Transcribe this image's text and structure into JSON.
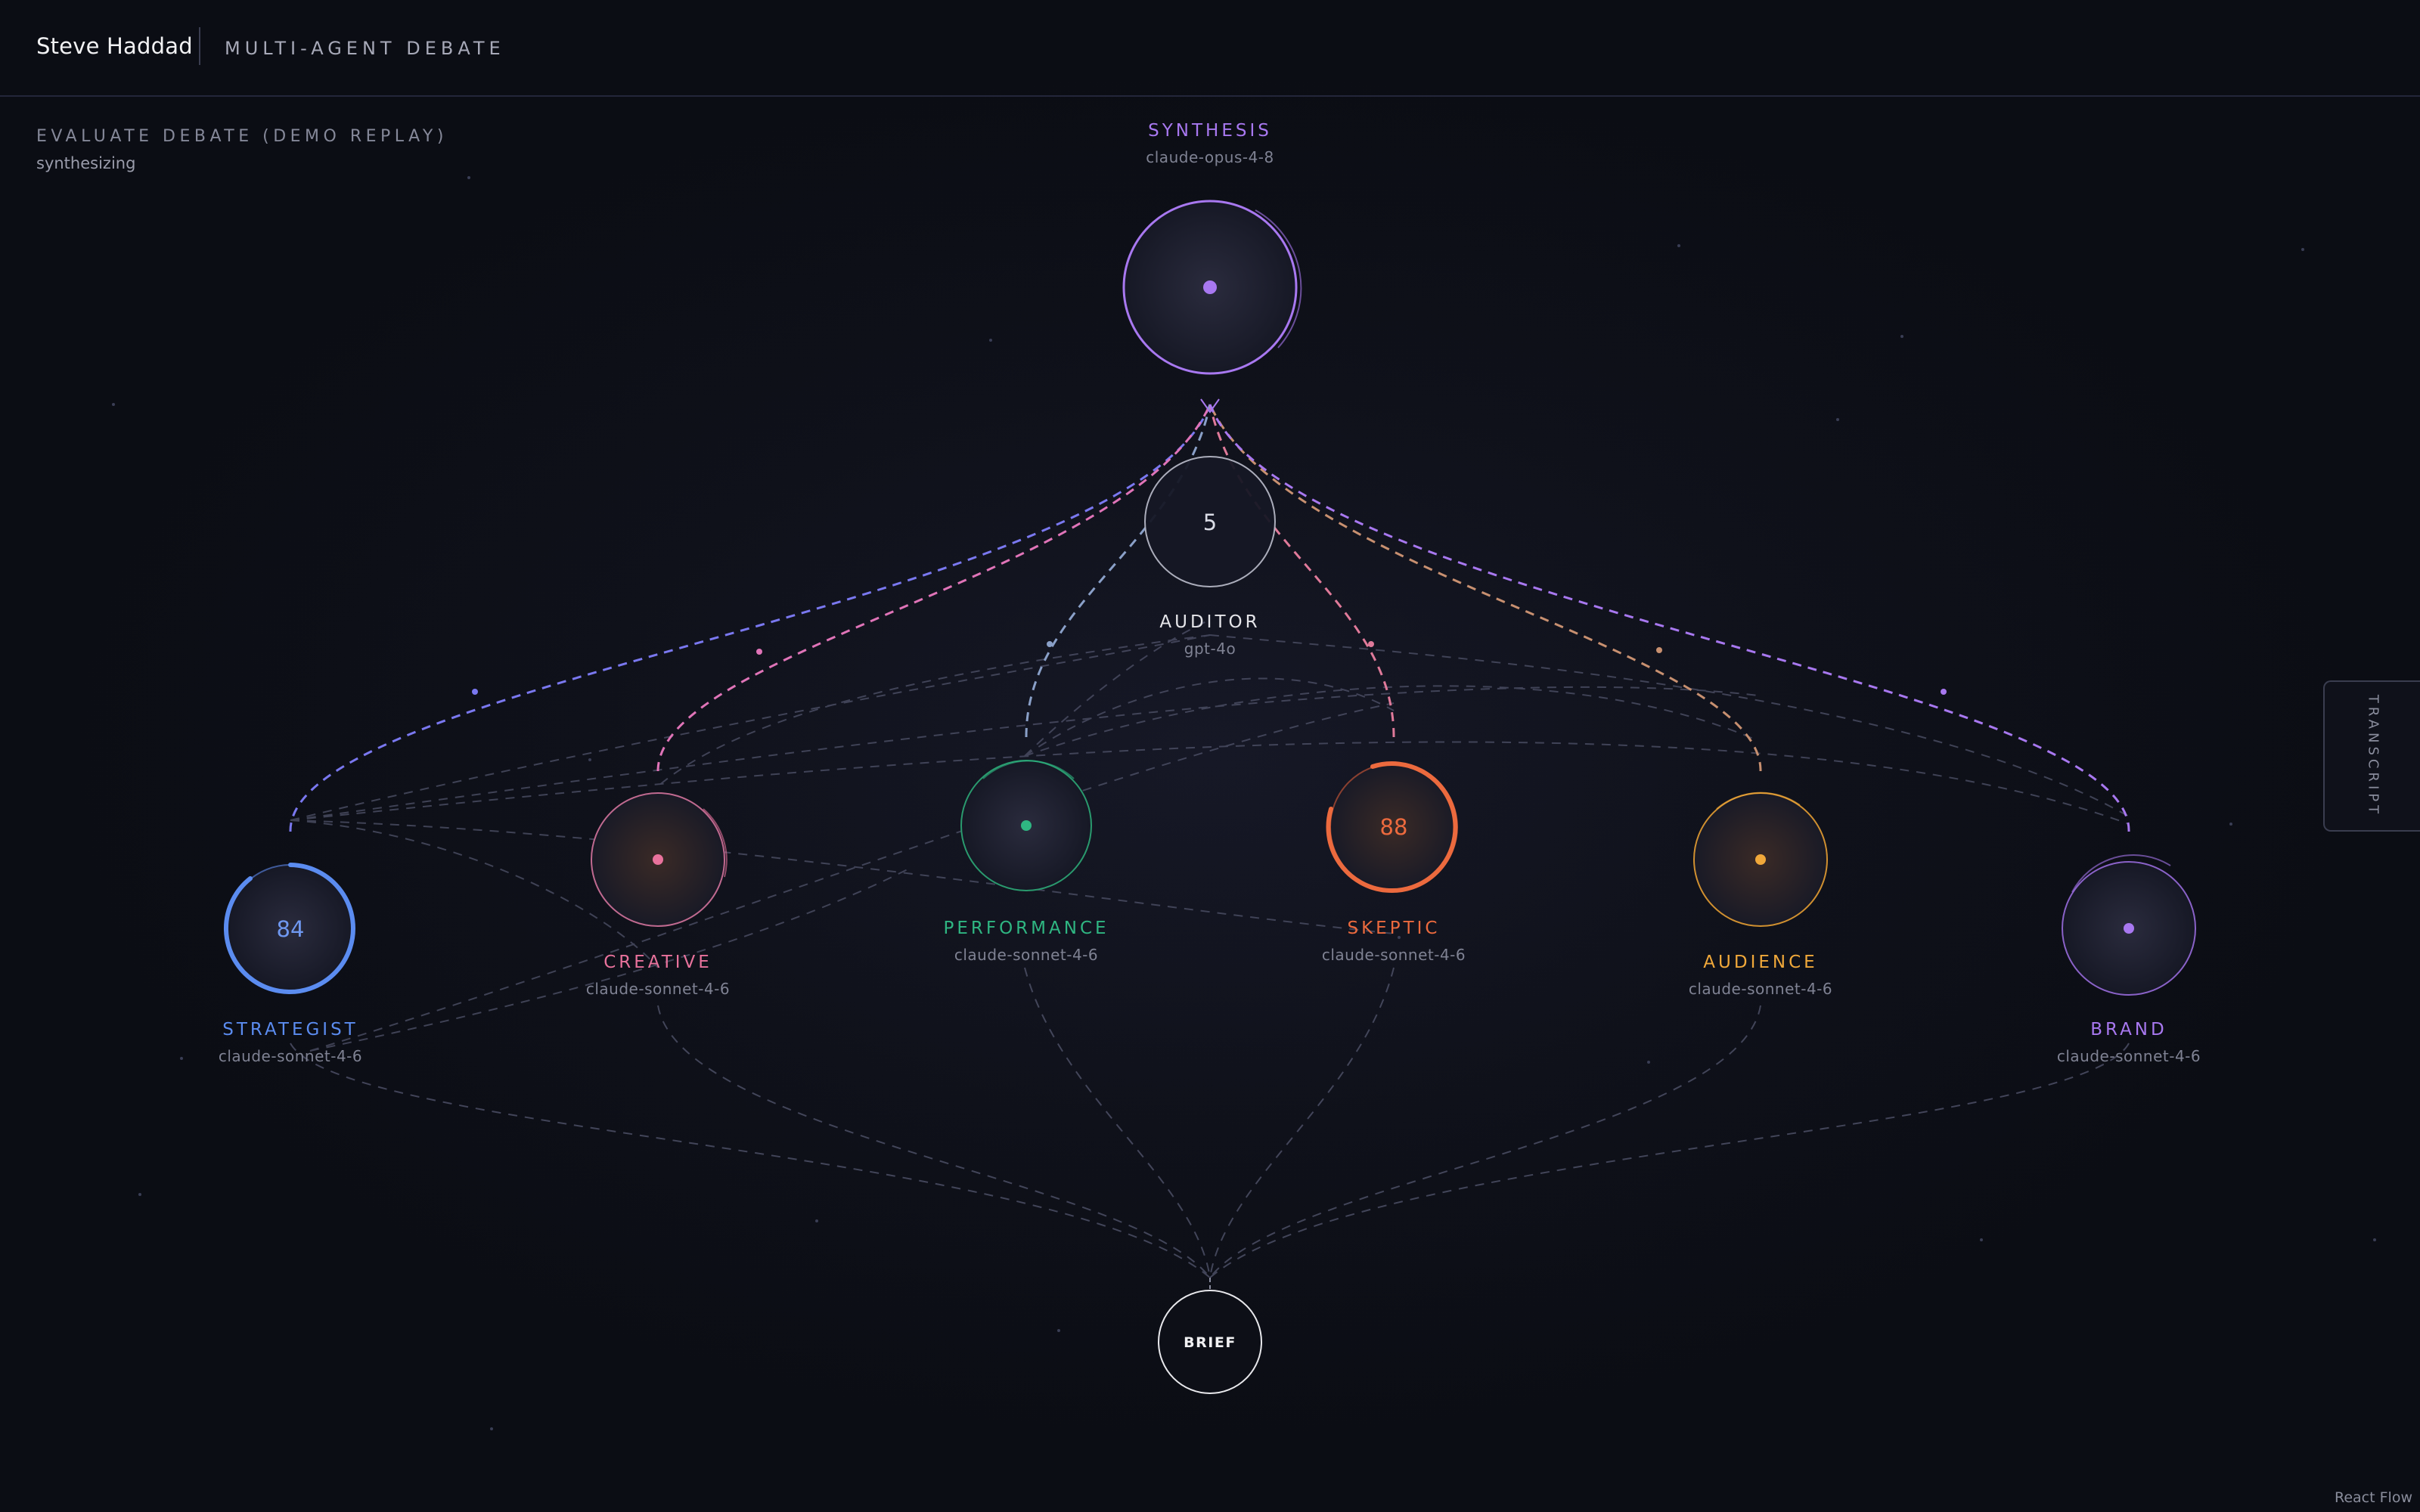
{
  "header": {
    "brand": "Steve Haddad",
    "title": "MULTI-AGENT DEBATE"
  },
  "debate": {
    "title": "EVALUATE DEBATE (DEMO REPLAY)",
    "status": "synthesizing"
  },
  "nodes": {
    "synthesis": {
      "role": "SYNTHESIS",
      "model": "claude-opus-4-8",
      "color": "#a878f0"
    },
    "auditor": {
      "role": "AUDITOR",
      "model": "gpt-4o",
      "value": "5",
      "color": "#e8e8ea"
    },
    "strategist": {
      "role": "STRATEGIST",
      "model": "claude-sonnet-4-6",
      "score": "84",
      "color": "#5b8cf0"
    },
    "creative": {
      "role": "CREATIVE",
      "model": "claude-sonnet-4-6",
      "color": "#e8729c"
    },
    "performance": {
      "role": "PERFORMANCE",
      "model": "claude-sonnet-4-6",
      "color": "#2fb682"
    },
    "skeptic": {
      "role": "SKEPTIC",
      "model": "claude-sonnet-4-6",
      "score": "88",
      "color": "#ec6a3e"
    },
    "audience": {
      "role": "AUDIENCE",
      "model": "claude-sonnet-4-6",
      "color": "#f0a83a"
    },
    "brand": {
      "role": "BRAND",
      "model": "claude-sonnet-4-6",
      "color": "#a878f0"
    },
    "brief": {
      "label": "BRIEF"
    }
  },
  "sidebar": {
    "transcript_label": "TRANSCRIPT"
  },
  "footer": {
    "attribution": "React Flow"
  }
}
